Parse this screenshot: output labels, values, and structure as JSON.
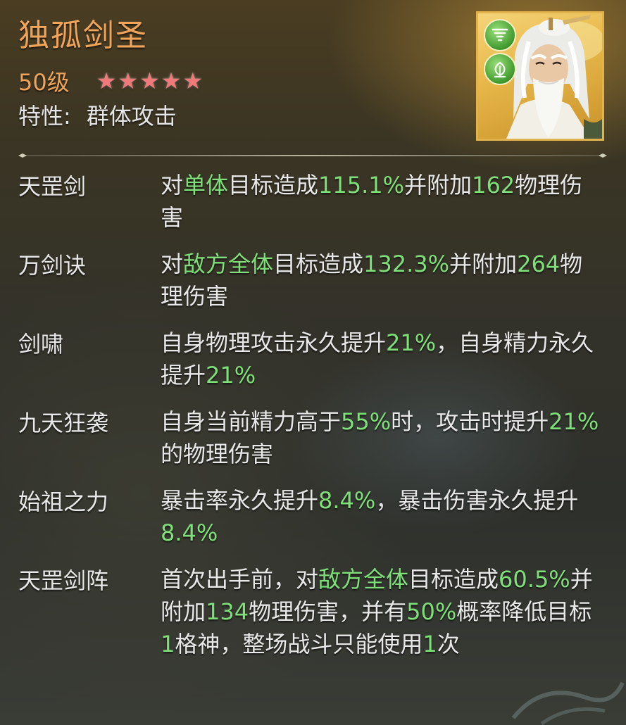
{
  "hero": {
    "name": "独孤剑圣",
    "level": "50级",
    "stars": [
      "★",
      "★",
      "★",
      "★",
      "★"
    ],
    "trait_label": "特性:",
    "trait_value": "群体攻击",
    "badges": [
      "tornado-icon",
      "leaf-icon"
    ]
  },
  "colors": {
    "name": "#f0a45a",
    "highlight": "#7fe07a",
    "star": "#f07a7a",
    "frame": "#e2b24d"
  },
  "skills": [
    {
      "name": "天罡剑",
      "segments": [
        {
          "t": "对"
        },
        {
          "t": "单体",
          "h": true
        },
        {
          "t": "目标造成"
        },
        {
          "t": "115.1%",
          "h": true
        },
        {
          "t": "并附加"
        },
        {
          "t": "162",
          "h": true
        },
        {
          "t": "物理伤害"
        }
      ]
    },
    {
      "name": "万剑诀",
      "segments": [
        {
          "t": "对"
        },
        {
          "t": "敌方全体",
          "h": true
        },
        {
          "t": "目标造成"
        },
        {
          "t": "132.3%",
          "h": true
        },
        {
          "t": "并附加"
        },
        {
          "t": "264",
          "h": true
        },
        {
          "t": "物理伤害"
        }
      ]
    },
    {
      "name": "剑啸",
      "segments": [
        {
          "t": "自身物理攻击永久提升"
        },
        {
          "t": "21%",
          "h": true
        },
        {
          "t": "，自身精力永久提升"
        },
        {
          "t": "21%",
          "h": true
        }
      ]
    },
    {
      "name": "九天狂袭",
      "segments": [
        {
          "t": "自身当前精力高于"
        },
        {
          "t": "55%",
          "h": true
        },
        {
          "t": "时，攻击时提升"
        },
        {
          "t": "21%",
          "h": true
        },
        {
          "t": "的物理伤害"
        }
      ]
    },
    {
      "name": "始祖之力",
      "segments": [
        {
          "t": "暴击率永久提升"
        },
        {
          "t": "8.4%",
          "h": true
        },
        {
          "t": "，暴击伤害永久提升"
        },
        {
          "t": "8.4%",
          "h": true
        }
      ]
    },
    {
      "name": "天罡剑阵",
      "segments": [
        {
          "t": "首次出手前，对"
        },
        {
          "t": "敌方全体",
          "h": true
        },
        {
          "t": "目标造成"
        },
        {
          "t": "60.5%",
          "h": true
        },
        {
          "t": "并附加"
        },
        {
          "t": "134",
          "h": true
        },
        {
          "t": "物理伤害，并有"
        },
        {
          "t": "50%",
          "h": true
        },
        {
          "t": "概率降低目标"
        },
        {
          "t": "1",
          "h": true
        },
        {
          "t": "格神，整场战斗只能使用"
        },
        {
          "t": "1",
          "h": true
        },
        {
          "t": "次"
        }
      ]
    }
  ]
}
